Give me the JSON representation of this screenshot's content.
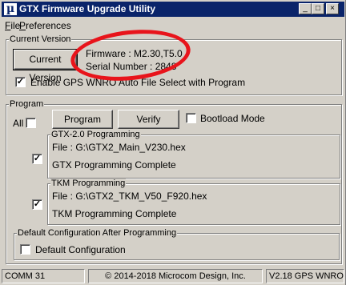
{
  "window": {
    "title": "GTX Firmware Upgrade Utility",
    "icon_symbol": "µ",
    "controls": {
      "minimize": "_",
      "maximize": "□",
      "close": "×"
    }
  },
  "menu": [
    {
      "label": "File",
      "accel": "F"
    },
    {
      "label": "Preferences",
      "accel": "P"
    }
  ],
  "current_version": {
    "group_label": "Current Version",
    "button_label": "Current Version",
    "firmware": "Firmware : M2.30,T5.0",
    "serial": "Serial Number : 2848",
    "auto_select_label": "Enable GPS WNRO Auto File Select with Program",
    "auto_select_checked": true
  },
  "program": {
    "group_label": "Program",
    "all_label": "All",
    "all_checked": false,
    "program_button": "Program",
    "verify_button": "Verify",
    "bootload_label": "Bootload Mode",
    "bootload_checked": false,
    "gtx": {
      "group_label": "GTX-2.0 Programming",
      "checked": true,
      "file": "File :  G:\\GTX2_Main_V230.hex",
      "status": "GTX Programming Complete"
    },
    "tkm": {
      "group_label": "TKM Programming",
      "checked": true,
      "file": "File :  G:\\GTX2_TKM_V50_F920.hex",
      "status": "TKM Programming Complete"
    }
  },
  "default_config": {
    "group_label": "Default Configuration After Programming",
    "checkbox_label": "Default Configuration",
    "checked": false
  },
  "statusbar": {
    "port": "COMM 31",
    "copyright": "© 2014-2018 Microcom Design, Inc.",
    "version": "V2.18 GPS WNRO"
  },
  "annotation_color": "#e8141b",
  "check_mark": "✓"
}
